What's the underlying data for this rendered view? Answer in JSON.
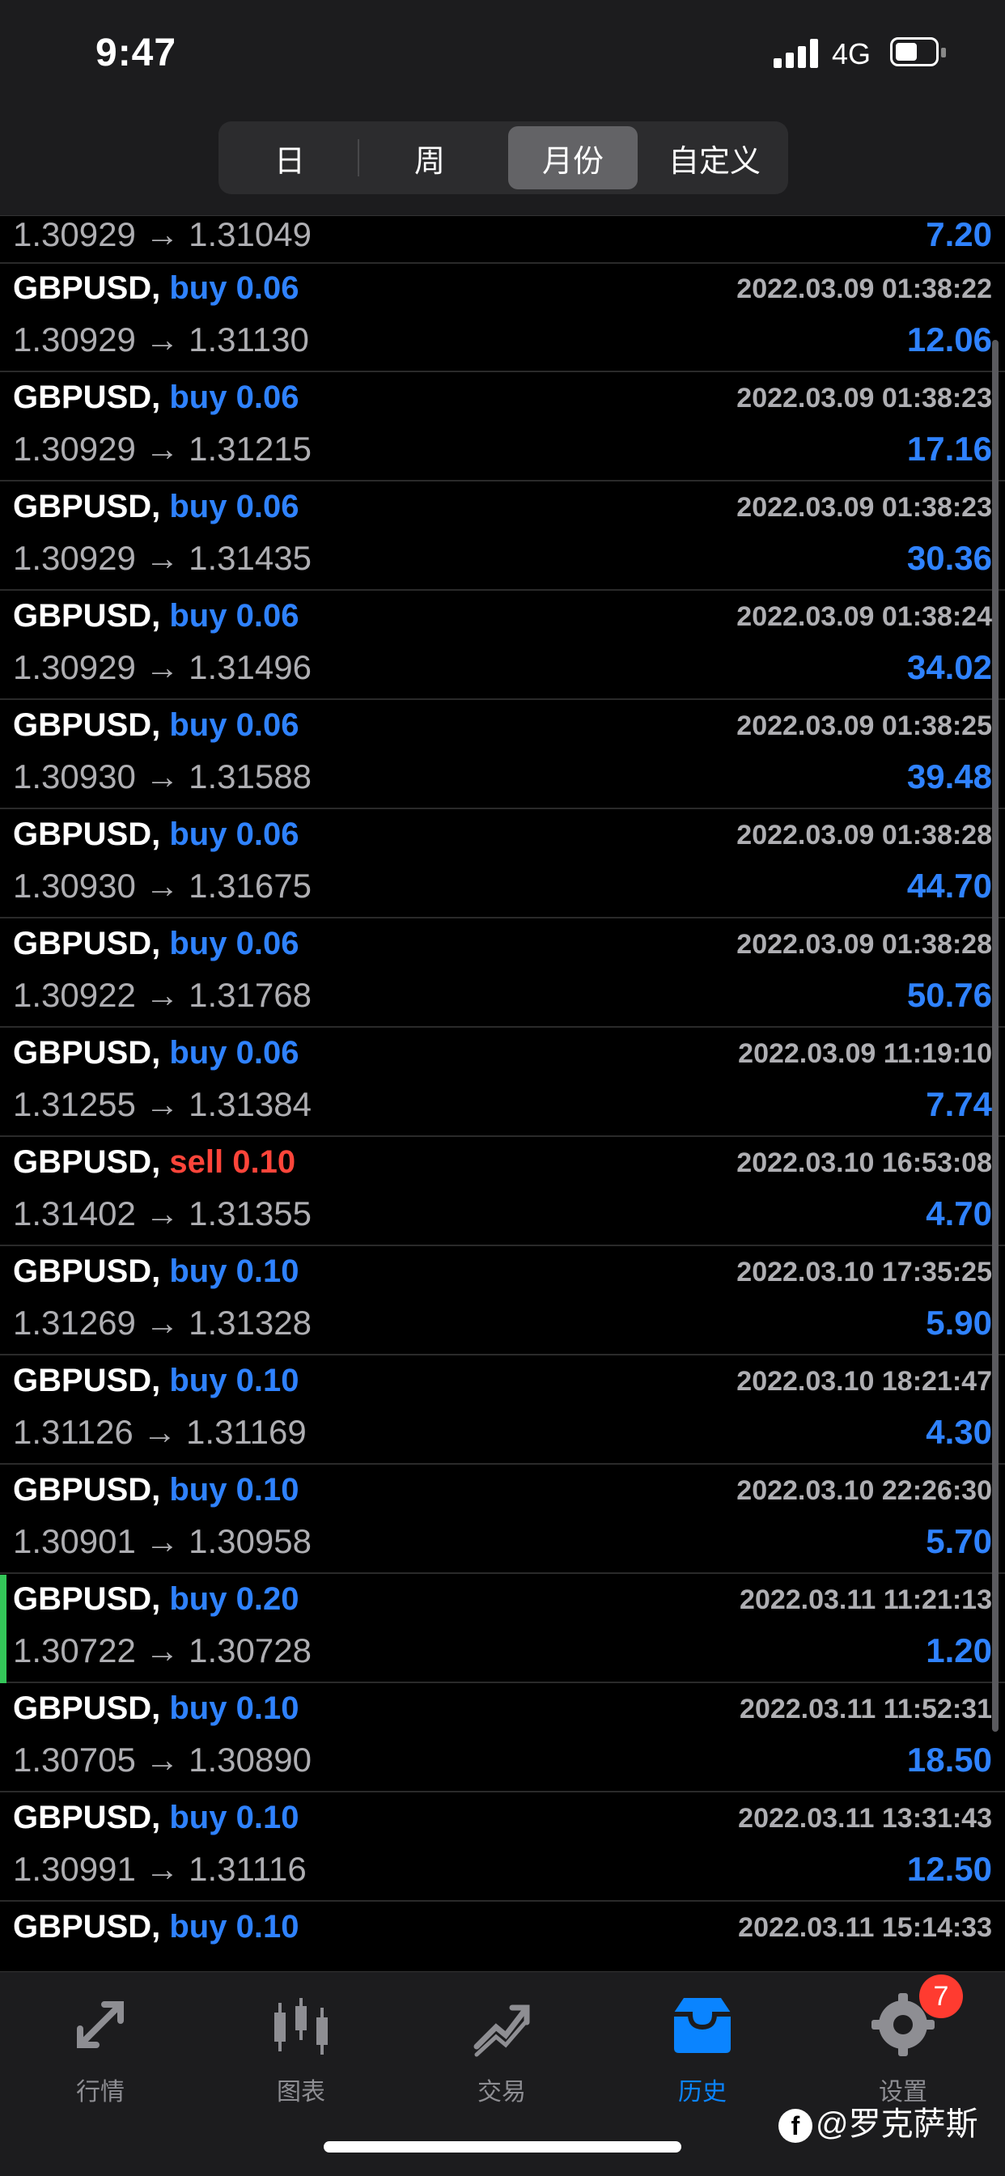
{
  "status_bar": {
    "time": "9:47",
    "network": "4G"
  },
  "segment": {
    "items": [
      "日",
      "周",
      "月份",
      "自定义"
    ],
    "active_index": 2
  },
  "top_partial_row": {
    "price": "1.30929 → 1.31049",
    "profit": "7.20"
  },
  "rows": [
    {
      "symbol": "GBPUSD,",
      "side": "buy 0.06",
      "type": "buy",
      "datetime": "2022.03.09 01:38:22",
      "price": "1.30929 → 1.31130",
      "profit": "12.06"
    },
    {
      "symbol": "GBPUSD,",
      "side": "buy 0.06",
      "type": "buy",
      "datetime": "2022.03.09 01:38:23",
      "price": "1.30929 → 1.31215",
      "profit": "17.16"
    },
    {
      "symbol": "GBPUSD,",
      "side": "buy 0.06",
      "type": "buy",
      "datetime": "2022.03.09 01:38:23",
      "price": "1.30929 → 1.31435",
      "profit": "30.36"
    },
    {
      "symbol": "GBPUSD,",
      "side": "buy 0.06",
      "type": "buy",
      "datetime": "2022.03.09 01:38:24",
      "price": "1.30929 → 1.31496",
      "profit": "34.02"
    },
    {
      "symbol": "GBPUSD,",
      "side": "buy 0.06",
      "type": "buy",
      "datetime": "2022.03.09 01:38:25",
      "price": "1.30930 → 1.31588",
      "profit": "39.48"
    },
    {
      "symbol": "GBPUSD,",
      "side": "buy 0.06",
      "type": "buy",
      "datetime": "2022.03.09 01:38:28",
      "price": "1.30930 → 1.31675",
      "profit": "44.70"
    },
    {
      "symbol": "GBPUSD,",
      "side": "buy 0.06",
      "type": "buy",
      "datetime": "2022.03.09 01:38:28",
      "price": "1.30922 → 1.31768",
      "profit": "50.76"
    },
    {
      "symbol": "GBPUSD,",
      "side": "buy 0.06",
      "type": "buy",
      "datetime": "2022.03.09 11:19:10",
      "price": "1.31255 → 1.31384",
      "profit": "7.74"
    },
    {
      "symbol": "GBPUSD,",
      "side": "sell 0.10",
      "type": "sell",
      "datetime": "2022.03.10 16:53:08",
      "price": "1.31402 → 1.31355",
      "profit": "4.70"
    },
    {
      "symbol": "GBPUSD,",
      "side": "buy 0.10",
      "type": "buy",
      "datetime": "2022.03.10 17:35:25",
      "price": "1.31269 → 1.31328",
      "profit": "5.90"
    },
    {
      "symbol": "GBPUSD,",
      "side": "buy 0.10",
      "type": "buy",
      "datetime": "2022.03.10 18:21:47",
      "price": "1.31126 → 1.31169",
      "profit": "4.30"
    },
    {
      "symbol": "GBPUSD,",
      "side": "buy 0.10",
      "type": "buy",
      "datetime": "2022.03.10 22:26:30",
      "price": "1.30901 → 1.30958",
      "profit": "5.70"
    },
    {
      "symbol": "GBPUSD,",
      "side": "buy 0.20",
      "type": "buy",
      "datetime": "2022.03.11 11:21:13",
      "price": "1.30722 → 1.30728",
      "profit": "1.20",
      "marker": true
    },
    {
      "symbol": "GBPUSD,",
      "side": "buy 0.10",
      "type": "buy",
      "datetime": "2022.03.11 11:52:31",
      "price": "1.30705 → 1.30890",
      "profit": "18.50"
    },
    {
      "symbol": "GBPUSD,",
      "side": "buy 0.10",
      "type": "buy",
      "datetime": "2022.03.11 13:31:43",
      "price": "1.30991 → 1.31116",
      "profit": "12.50"
    },
    {
      "symbol": "GBPUSD,",
      "side": "buy 0.10",
      "type": "buy",
      "datetime": "2022.03.11 15:14:33",
      "price": "",
      "profit": ""
    }
  ],
  "tabs": [
    {
      "label": "行情",
      "icon": "quotes-icon"
    },
    {
      "label": "图表",
      "icon": "chart-icon"
    },
    {
      "label": "交易",
      "icon": "trade-icon"
    },
    {
      "label": "历史",
      "icon": "history-icon",
      "active": true
    },
    {
      "label": "设置",
      "icon": "settings-icon"
    }
  ],
  "settings_badge": "7",
  "watermark": "@罗克萨斯",
  "colors": {
    "accent": "#2f82ff",
    "sell": "#ff453a",
    "marker": "#34c759"
  }
}
